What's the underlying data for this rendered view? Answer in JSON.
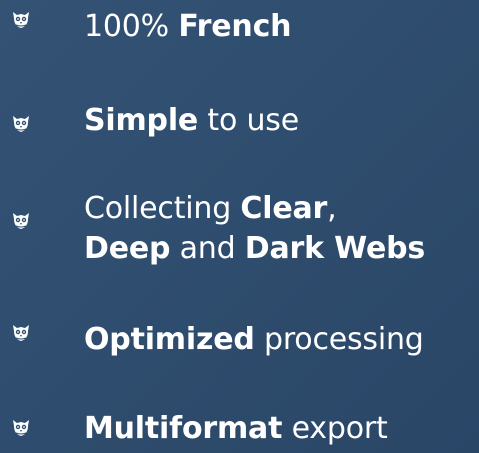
{
  "features": [
    {
      "icon": "owl-icon",
      "lines": [
        [
          {
            "text": "100% ",
            "bold": false
          },
          {
            "text": "French",
            "bold": true
          }
        ]
      ]
    },
    {
      "icon": "owl-icon",
      "lines": [
        [
          {
            "text": "Simple",
            "bold": true
          },
          {
            "text": " to use",
            "bold": false
          }
        ]
      ]
    },
    {
      "icon": "owl-icon",
      "lines": [
        [
          {
            "text": "Collecting ",
            "bold": false
          },
          {
            "text": "Clear",
            "bold": true
          },
          {
            "text": ",",
            "bold": false
          }
        ],
        [
          {
            "text": "Deep",
            "bold": true
          },
          {
            "text": " and ",
            "bold": false
          },
          {
            "text": "Dark Webs",
            "bold": true
          }
        ]
      ]
    },
    {
      "icon": "owl-icon",
      "lines": [
        [
          {
            "text": "Optimized",
            "bold": true
          },
          {
            "text": " processing",
            "bold": false
          }
        ]
      ]
    },
    {
      "icon": "owl-icon",
      "lines": [
        [
          {
            "text": "Multiformat",
            "bold": true
          },
          {
            "text": " export",
            "bold": false
          }
        ]
      ]
    }
  ]
}
